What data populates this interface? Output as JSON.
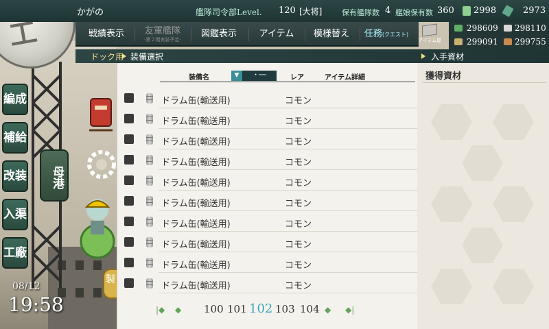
{
  "topbar": {
    "admiral_name": "かがの",
    "level_label": "艦隊司令部Level.",
    "level": "120",
    "rank": "[大将]",
    "ships_label": "保有艦隊数",
    "ships_count": "4",
    "shipgirls_label": "艦娘保有数",
    "shipgirls_count": "360",
    "equip_count": "2998",
    "furniture_count": "2973"
  },
  "menu": {
    "items": [
      {
        "label": "戦績表示"
      },
      {
        "label": "友軍艦隊",
        "sub": "-第２期実装予定-"
      },
      {
        "label": "図鑑表示"
      },
      {
        "label": "アイテム"
      },
      {
        "label": "模様替え"
      },
      {
        "label": "任務",
        "small": "(クエスト)"
      }
    ],
    "item_shop": "アイテム屋"
  },
  "resources": {
    "fuel": "298609",
    "ammo": "298110",
    "steel": "299091",
    "bauxite": "299755"
  },
  "breadcrumb": {
    "dock": "ドック用",
    "current": "装備選択",
    "right": "入手資材"
  },
  "side_nav": {
    "items": [
      "編成",
      "補給",
      "改装",
      "入渠",
      "工廠"
    ],
    "port": "母港"
  },
  "clock": {
    "date": "08/12",
    "time": "19:58"
  },
  "list": {
    "headers": {
      "name": "装備名",
      "sort": "▼",
      "dash": "・──",
      "rarity": "レア",
      "detail": "アイテム詳細"
    },
    "rows": [
      {
        "name": "ドラム缶(輸送用)",
        "rarity": "コモン"
      },
      {
        "name": "ドラム缶(輸送用)",
        "rarity": "コモン"
      },
      {
        "name": "ドラム缶(輸送用)",
        "rarity": "コモン"
      },
      {
        "name": "ドラム缶(輸送用)",
        "rarity": "コモン"
      },
      {
        "name": "ドラム缶(輸送用)",
        "rarity": "コモン"
      },
      {
        "name": "ドラム缶(輸送用)",
        "rarity": "コモン"
      },
      {
        "name": "ドラム缶(輸送用)",
        "rarity": "コモン"
      },
      {
        "name": "ドラム缶(輸送用)",
        "rarity": "コモン"
      },
      {
        "name": "ドラム缶(輸送用)",
        "rarity": "コモン"
      },
      {
        "name": "ドラム缶(輸送用)",
        "rarity": "コモン"
      }
    ],
    "pager": {
      "pages": [
        "100",
        "101",
        "102",
        "103",
        "104"
      ],
      "current": "102"
    }
  },
  "right_panel": {
    "title": "獲得資材"
  },
  "dev_button_label": "製"
}
